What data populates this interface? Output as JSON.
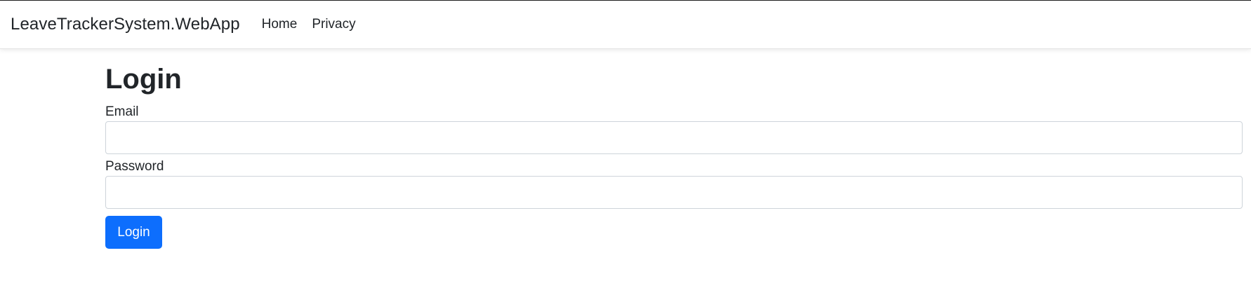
{
  "nav": {
    "brand": "LeaveTrackerSystem.WebApp",
    "links": [
      {
        "label": "Home"
      },
      {
        "label": "Privacy"
      }
    ]
  },
  "page": {
    "title": "Login"
  },
  "form": {
    "email": {
      "label": "Email",
      "value": "",
      "placeholder": ""
    },
    "password": {
      "label": "Password",
      "value": "",
      "placeholder": ""
    },
    "submit_label": "Login"
  },
  "colors": {
    "primary": "#0d6efd",
    "text": "#212529",
    "input_border": "#ced4da"
  }
}
